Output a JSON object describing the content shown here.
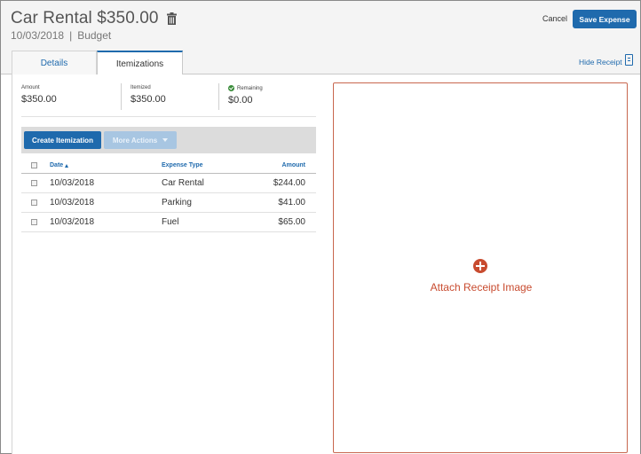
{
  "header": {
    "title": "Car Rental $350.00",
    "date": "10/03/2018",
    "separator": "|",
    "policy": "Budget",
    "cancel_label": "Cancel",
    "save_label": "Save Expense"
  },
  "tabs": [
    {
      "label": "Details",
      "active": false
    },
    {
      "label": "Itemizations",
      "active": true
    }
  ],
  "receipt_toggle": {
    "label": "Hide Receipt",
    "icon": "receipt-icon"
  },
  "summary": {
    "amount_label": "Amount",
    "amount_value": "$350.00",
    "itemized_label": "Itemized",
    "itemized_value": "$350.00",
    "remaining_label": "Remaining",
    "remaining_value": "$0.00",
    "remaining_icon": "check-circle-icon"
  },
  "toolbar": {
    "create_label": "Create Itemization",
    "more_label": "More Actions"
  },
  "table": {
    "columns": {
      "date": "Date",
      "type": "Expense Type",
      "amount": "Amount"
    },
    "rows": [
      {
        "date": "10/03/2018",
        "type": "Car Rental",
        "amount": "$244.00"
      },
      {
        "date": "10/03/2018",
        "type": "Parking",
        "amount": "$41.00"
      },
      {
        "date": "10/03/2018",
        "type": "Fuel",
        "amount": "$65.00"
      }
    ]
  },
  "receipt": {
    "attach_label": "Attach Receipt Image",
    "icon": "plus-circle-icon"
  },
  "colors": {
    "primary": "#1f6aad",
    "accent": "#c84b2f",
    "success": "#3a8c3a"
  }
}
